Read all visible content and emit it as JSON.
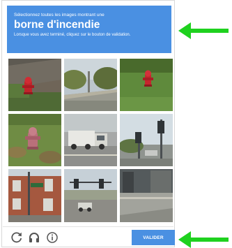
{
  "captcha": {
    "header": {
      "prompt_line": "Sélectionnez toutes les images montrant une",
      "target_object": "borne d'incendie",
      "instruction_line": "Lorsque vous avez terminé, cliquez sur le bouton de validation."
    },
    "tiles": [
      {
        "content": "fire hydrant on grass"
      },
      {
        "content": "road with trees"
      },
      {
        "content": "fire hydrant on grass"
      },
      {
        "content": "fire hydrant on grass"
      },
      {
        "content": "truck on highway"
      },
      {
        "content": "traffic lights at intersection"
      },
      {
        "content": "brick building with street sign"
      },
      {
        "content": "traffic lights on street"
      },
      {
        "content": "street with buildings"
      }
    ],
    "footer": {
      "reload_icon": "reload-icon",
      "audio_icon": "headphones-icon",
      "info_icon": "info-icon",
      "verify_label": "VALIDER"
    }
  },
  "annotations": {
    "arrow_color": "#1fd11f",
    "arrow_icons": [
      "arrow-left-icon",
      "arrow-left-icon"
    ]
  },
  "colors": {
    "accent": "#4a90e2",
    "footer_icon": "#555555"
  }
}
